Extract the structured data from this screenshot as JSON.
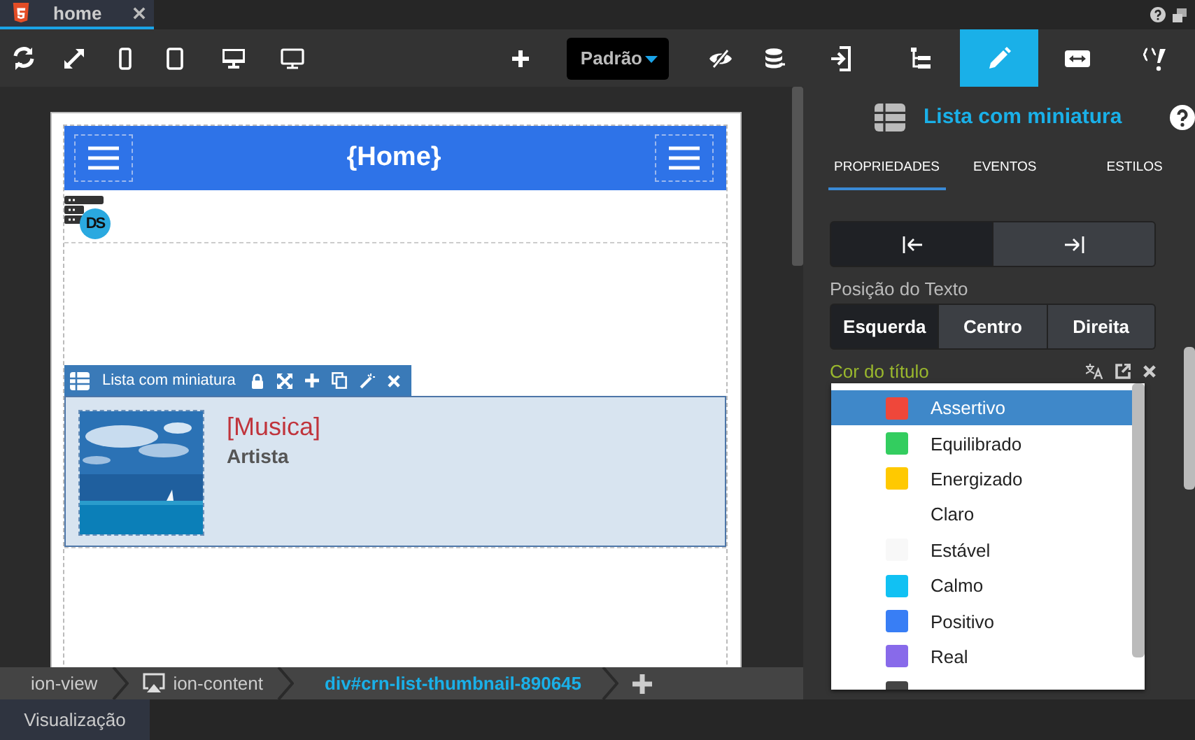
{
  "editor_tabs": [
    {
      "label": "home",
      "selected": true
    }
  ],
  "toolbar": {
    "device_preset": "Padrão"
  },
  "canvas": {
    "page_title": "{Home}",
    "badge": "DS",
    "component_toolbar": {
      "label": "Lista com miniatura"
    },
    "list_item": {
      "title": "[Musica]",
      "subtitle": "Artista"
    }
  },
  "breadcrumb": [
    {
      "label": "ion-view",
      "selected": false
    },
    {
      "label": "ion-content",
      "selected": false
    },
    {
      "label": "div#crn-list-thumbnail-890645",
      "selected": true
    }
  ],
  "bottom_tabs": [
    {
      "label": "Visualização",
      "selected": true
    }
  ],
  "panel": {
    "tabs": [
      {
        "kind": "enter",
        "selected": false
      },
      {
        "kind": "tree",
        "selected": false
      },
      {
        "kind": "pencil",
        "selected": true
      },
      {
        "kind": "resize",
        "selected": false
      },
      {
        "kind": "code",
        "selected": false
      }
    ],
    "component_title": "Lista com miniatura",
    "sub_tabs": [
      {
        "label": "PROPRIEDADES",
        "selected": true
      },
      {
        "label": "EVENTOS",
        "selected": false
      },
      {
        "label": "ESTILOS",
        "selected": false
      }
    ],
    "icon_position": [
      {
        "kind": "left",
        "selected": true
      },
      {
        "kind": "right",
        "selected": false
      }
    ],
    "text_position": {
      "label": "Posição do Texto",
      "options": [
        {
          "label": "Esquerda",
          "selected": true
        },
        {
          "label": "Centro",
          "selected": false
        },
        {
          "label": "Direita",
          "selected": false
        }
      ]
    },
    "title_color": {
      "label": "Cor do título",
      "options": [
        {
          "label": "Assertivo",
          "color": "#ef473a",
          "selected": true
        },
        {
          "label": "Equilibrado",
          "color": "#33cd5f",
          "selected": false
        },
        {
          "label": "Energizado",
          "color": "#ffc900",
          "selected": false
        },
        {
          "label": "Claro",
          "color": "#ffffff",
          "selected": false
        },
        {
          "label": "Estável",
          "color": "#f8f8f8",
          "selected": false
        },
        {
          "label": "Calmo",
          "color": "#11c1f3",
          "selected": false
        },
        {
          "label": "Positivo",
          "color": "#387ef5",
          "selected": false
        },
        {
          "label": "Real",
          "color": "#886aea",
          "selected": false
        },
        {
          "color": "#444444",
          "selected": false
        }
      ]
    }
  }
}
